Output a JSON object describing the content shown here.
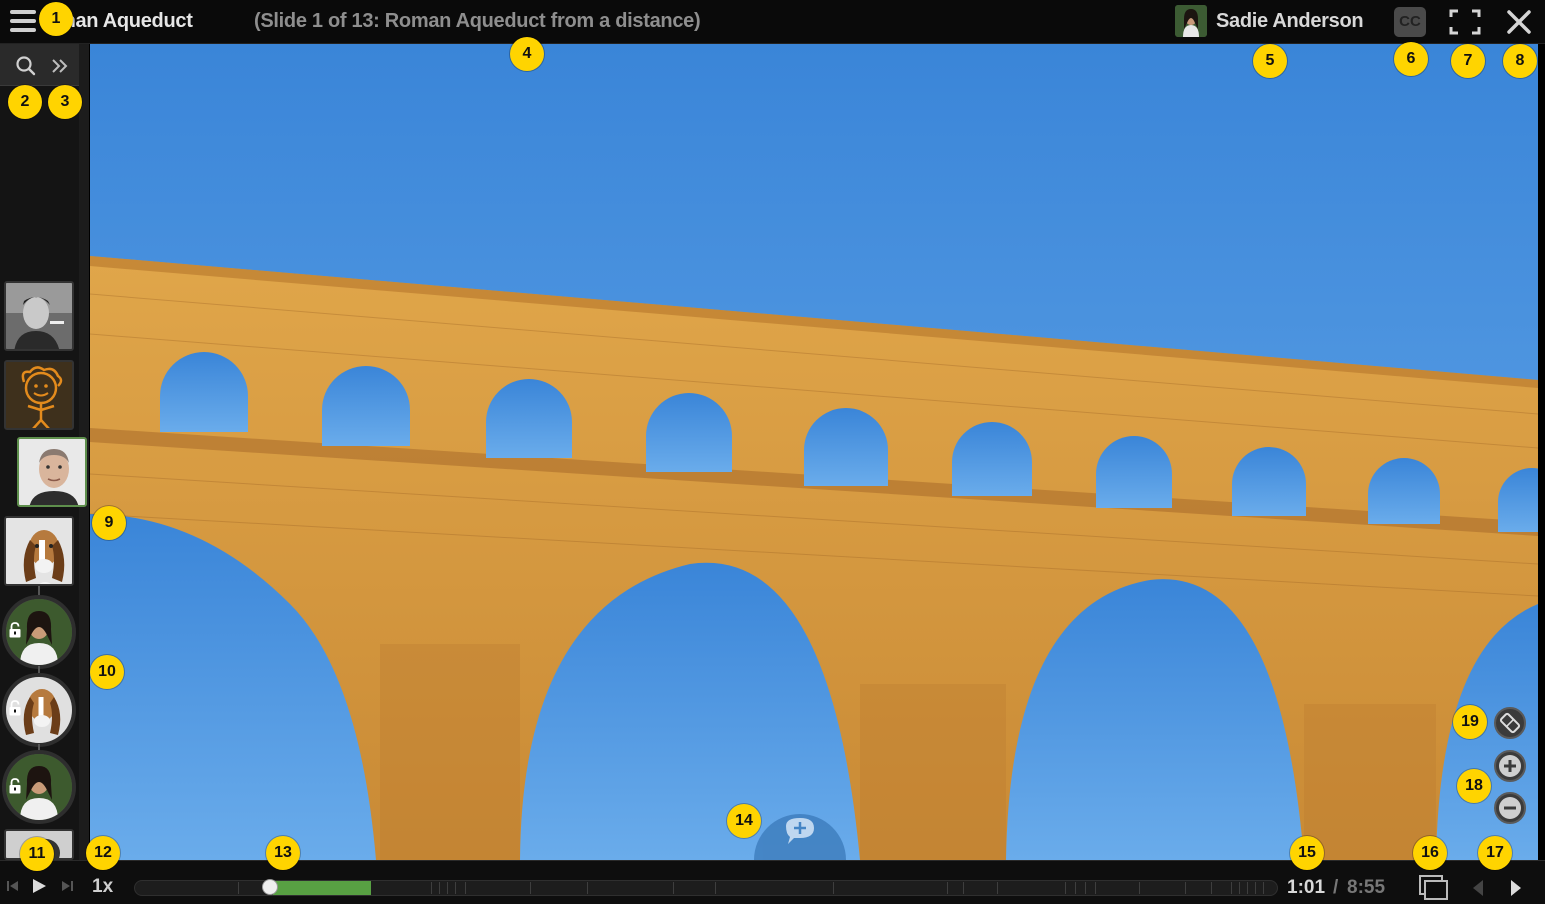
{
  "header": {
    "app_title": "man Aqueduct",
    "slide_title": "(Slide 1 of 13: Roman Aqueduct from a distance)",
    "user_name": "Sadie Anderson",
    "cc_label": "CC",
    "menu_icon": "hamburger-icon",
    "fullscreen_icon": "fullscreen-icon",
    "close_icon": "close-icon"
  },
  "sidebar": {
    "search_icon": "search-icon",
    "expand_icon": "double-chevron-right-icon",
    "thumbnails": [
      {
        "name": "man-with-cigarette",
        "style": "square",
        "locked": false,
        "active": false
      },
      {
        "name": "cartoon-face",
        "style": "square",
        "locked": false,
        "active": false
      },
      {
        "name": "bald-man",
        "style": "square",
        "locked": false,
        "active": true
      },
      {
        "name": "basset-hound",
        "style": "square",
        "locked": false,
        "active": false
      },
      {
        "name": "woman",
        "style": "round",
        "locked": true,
        "active": false
      },
      {
        "name": "basset-hound",
        "style": "round",
        "locked": true,
        "active": false
      },
      {
        "name": "woman",
        "style": "round",
        "locked": true,
        "active": false
      },
      {
        "name": "partial",
        "style": "square",
        "locked": false,
        "active": false
      }
    ]
  },
  "playback": {
    "speed": "1x",
    "current_time": "1:01",
    "separator": "/",
    "total_time": "8:55",
    "progress_fraction": 0.118
  },
  "callouts": [
    "1",
    "2",
    "3",
    "4",
    "5",
    "6",
    "7",
    "8",
    "9",
    "10",
    "11",
    "12",
    "13",
    "14",
    "15",
    "16",
    "17",
    "18",
    "19"
  ],
  "colors": {
    "accent_green": "#58a043",
    "marker_yellow": "#ffd400",
    "sky": "#3b86d9",
    "stone": "#d9a043"
  }
}
